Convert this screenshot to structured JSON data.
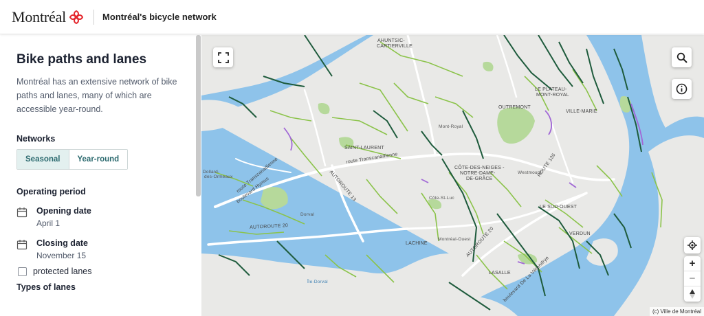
{
  "header": {
    "brand": "Montréal",
    "title": "Montréal's bicycle network",
    "logo_color": "#e4262c"
  },
  "sidebar": {
    "title": "Bike paths and lanes",
    "description": "Montréal has an extensive network of bike paths and lanes, many of which are accessible year-round.",
    "networks_heading": "Networks",
    "network_options": [
      "Seasonal",
      "Year-round"
    ],
    "network_selected": "Seasonal",
    "period_heading": "Operating period",
    "opening_label": "Opening date",
    "opening_value": "April 1",
    "closing_label": "Closing date",
    "closing_value": "November 15",
    "lane_types_heading": "Types of lanes",
    "lane_types": [
      {
        "label": "protected lanes",
        "checked": false
      }
    ]
  },
  "map": {
    "labels": {
      "ahuntsic": "AHUNTSIC-",
      "cartierville": "CARTIERVILLE",
      "plateau": "LE PLATEAU-",
      "mont_royal_borough": "MONT-ROYAL",
      "outremont": "OUTREMONT",
      "ville_marie": "VILLE-MARIE",
      "mont_royal": "Mont-Royal",
      "saint_laurent": "SAINT-LAURENT",
      "cdn1": "CÔTE-DES-NEIGES -",
      "cdn2": "NOTRE-DAME-",
      "cdn3": "DE-GRÂCE",
      "westmount": "Westmount",
      "route_136": "ROUTE 136",
      "sud_ouest": "LE SUD-OUEST",
      "verdun": "VERDUN",
      "lachine": "LACHINE",
      "montreal_ouest": "Montréal-Ouest",
      "cote_st_luc": "Côte-St-Luc",
      "dorval": "Dorval",
      "dollard": "Dollard-",
      "ormeaux": "des-Ormeaux",
      "lasalle": "LASALLE",
      "ile_dorval": "Île-Dorval",
      "transcanadienne1": "route Transcanadienne",
      "transcanadienne2": "route Transcanadienne",
      "hymus": "boulevard Hymus",
      "autoroute13": "AUTOROUTE 13",
      "autoroute20a": "AUTOROUTE 20",
      "autoroute20b": "AUTOROUTE 20",
      "lasalle_blvd": "boulevard De La Vérendrye"
    },
    "attribution": "(c) Ville de Montréal",
    "colors": {
      "land": "#e9e9e7",
      "water": "#8ec3ea",
      "park": "#b6d99b",
      "seasonal": "#8bc34a",
      "year_round": "#1e5b3c",
      "protected": "#a168d6",
      "highway": "#ffffff"
    },
    "controls": {
      "fullscreen": "fullscreen-icon",
      "search": "search-icon",
      "info": "info-icon",
      "locate": "locate-icon",
      "zoom_in": "+",
      "zoom_out": "−",
      "compass": "compass-icon"
    }
  }
}
